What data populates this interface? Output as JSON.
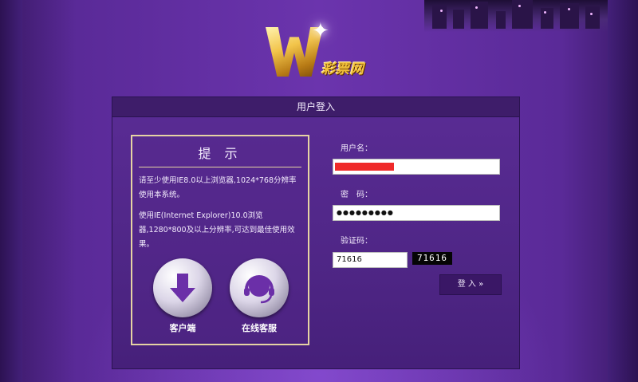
{
  "logo": {
    "text": "彩票网",
    "letter": "W"
  },
  "panel": {
    "title": "用户登入"
  },
  "tips": {
    "title": "提 示",
    "line1": "请至少使用IE8.0以上浏览器,1024*768分辨率使用本系统。",
    "line2": "使用IE(Internet Explorer)10.0浏览器,1280*800及以上分辨率,可达到最佳使用效果。"
  },
  "shortcuts": {
    "client_label": "客户端",
    "service_label": "在线客服"
  },
  "form": {
    "username_label": "用户名：",
    "password_label": "密　码：",
    "password_value": "●●●●●●●●●",
    "captcha_label": "验证码：",
    "captcha_value": "71616",
    "captcha_image_text": "71616",
    "submit_label": "登 入 »"
  },
  "colors": {
    "background": "#6b34ad",
    "panel_header": "#3e1d6a",
    "tips_border": "#e6d3a3",
    "redacted": "#ef2a2a"
  }
}
